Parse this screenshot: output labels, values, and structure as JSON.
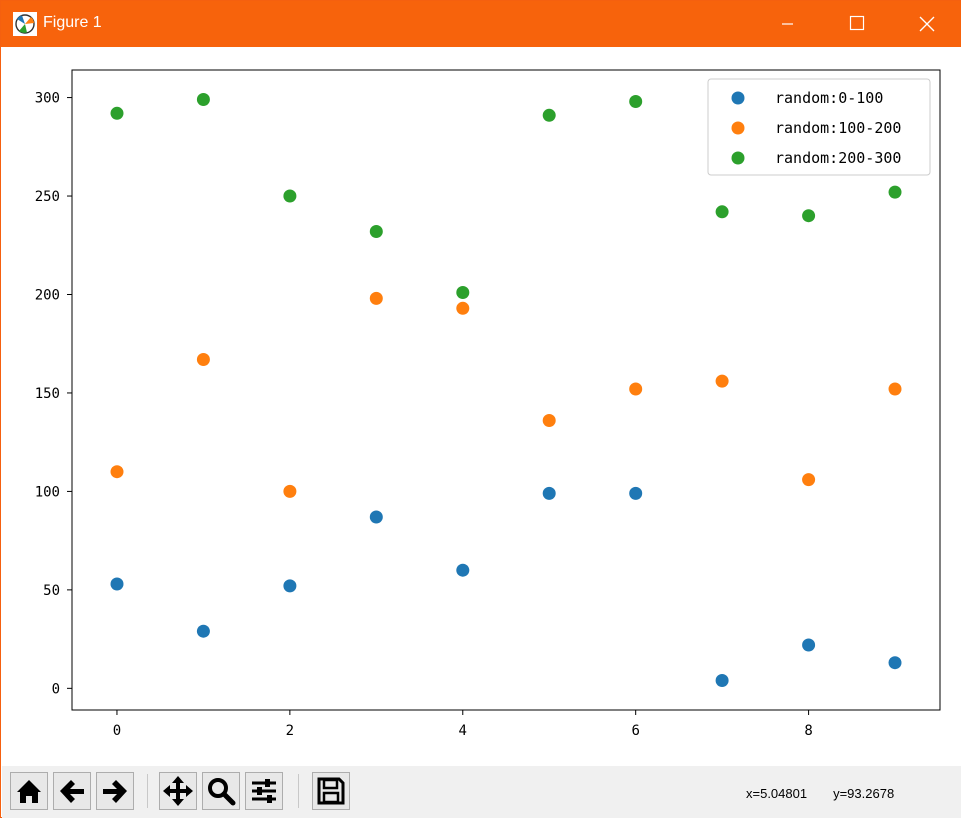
{
  "window": {
    "title": "Figure 1"
  },
  "toolbar": {
    "buttons": [
      "home-icon",
      "back-icon",
      "forward-icon",
      "pan-icon",
      "zoom-icon",
      "configure-subplots-icon",
      "save-icon"
    ],
    "coord_x": "x=5.04801",
    "coord_y": "y=93.2678"
  },
  "colors": {
    "titlebar": "#f7630c",
    "series": [
      "#1f77b4",
      "#ff7f0e",
      "#2ca02c"
    ]
  },
  "chart_data": {
    "type": "scatter",
    "title": "",
    "xlabel": "",
    "ylabel": "",
    "xlim": [
      -0.52,
      9.52
    ],
    "ylim": [
      -11,
      314
    ],
    "x_ticks": [
      0,
      2,
      4,
      6,
      8
    ],
    "y_ticks": [
      0,
      50,
      100,
      150,
      200,
      250,
      300
    ],
    "legend": "top-right",
    "grid": false,
    "x": [
      0,
      1,
      2,
      3,
      4,
      5,
      6,
      7,
      8,
      9
    ],
    "series": [
      {
        "name": "random:0-100",
        "color": "#1f77b4",
        "values": [
          53,
          29,
          52,
          87,
          60,
          99,
          99,
          4,
          22,
          13
        ]
      },
      {
        "name": "random:100-200",
        "color": "#ff7f0e",
        "values": [
          110,
          167,
          100,
          198,
          193,
          136,
          152,
          156,
          106,
          152
        ]
      },
      {
        "name": "random:200-300",
        "color": "#2ca02c",
        "values": [
          292,
          299,
          250,
          232,
          201,
          291,
          298,
          242,
          240,
          252
        ]
      }
    ]
  }
}
